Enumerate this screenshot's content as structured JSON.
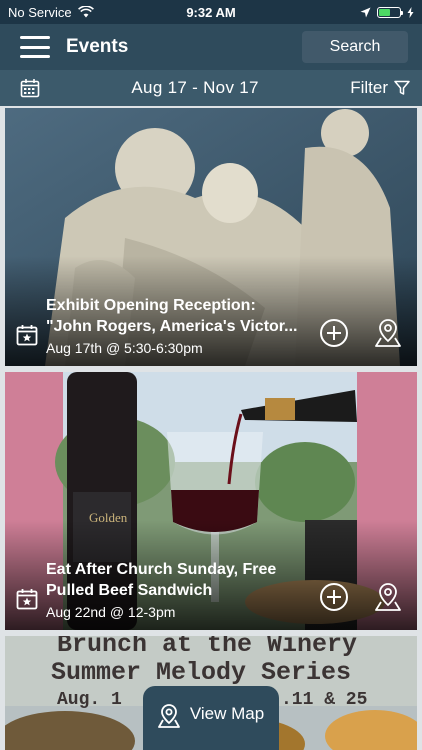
{
  "status_bar": {
    "carrier": "No Service",
    "time": "9:32 AM",
    "battery_level": 0.55
  },
  "navbar": {
    "title": "Events",
    "search_label": "Search"
  },
  "date_bar": {
    "range": "Aug 17  -  Nov 17",
    "filter_label": "Filter"
  },
  "events": [
    {
      "title_line1": "Exhibit Opening Reception:",
      "title_line2": "\"John Rogers, America's Victor...",
      "when": "Aug 17th @ 5:30-6:30pm"
    },
    {
      "title_line1": "Eat After Church Sunday, Free",
      "title_line2": "Pulled Beef Sandwich",
      "when": "Aug 22nd @ 12-3pm",
      "image_text": "Golden"
    },
    {
      "image_text_line1": "Brunch at the Winery",
      "image_text_line2": "Summer Melody Series",
      "image_text_line3": "Aug. 1",
      "image_text_line4": ".11 & 25"
    }
  ],
  "view_map_label": "View Map",
  "colors": {
    "statusbar": "#1d3546",
    "navbar": "#2f4b5c",
    "datebar": "#3c5a6b"
  }
}
